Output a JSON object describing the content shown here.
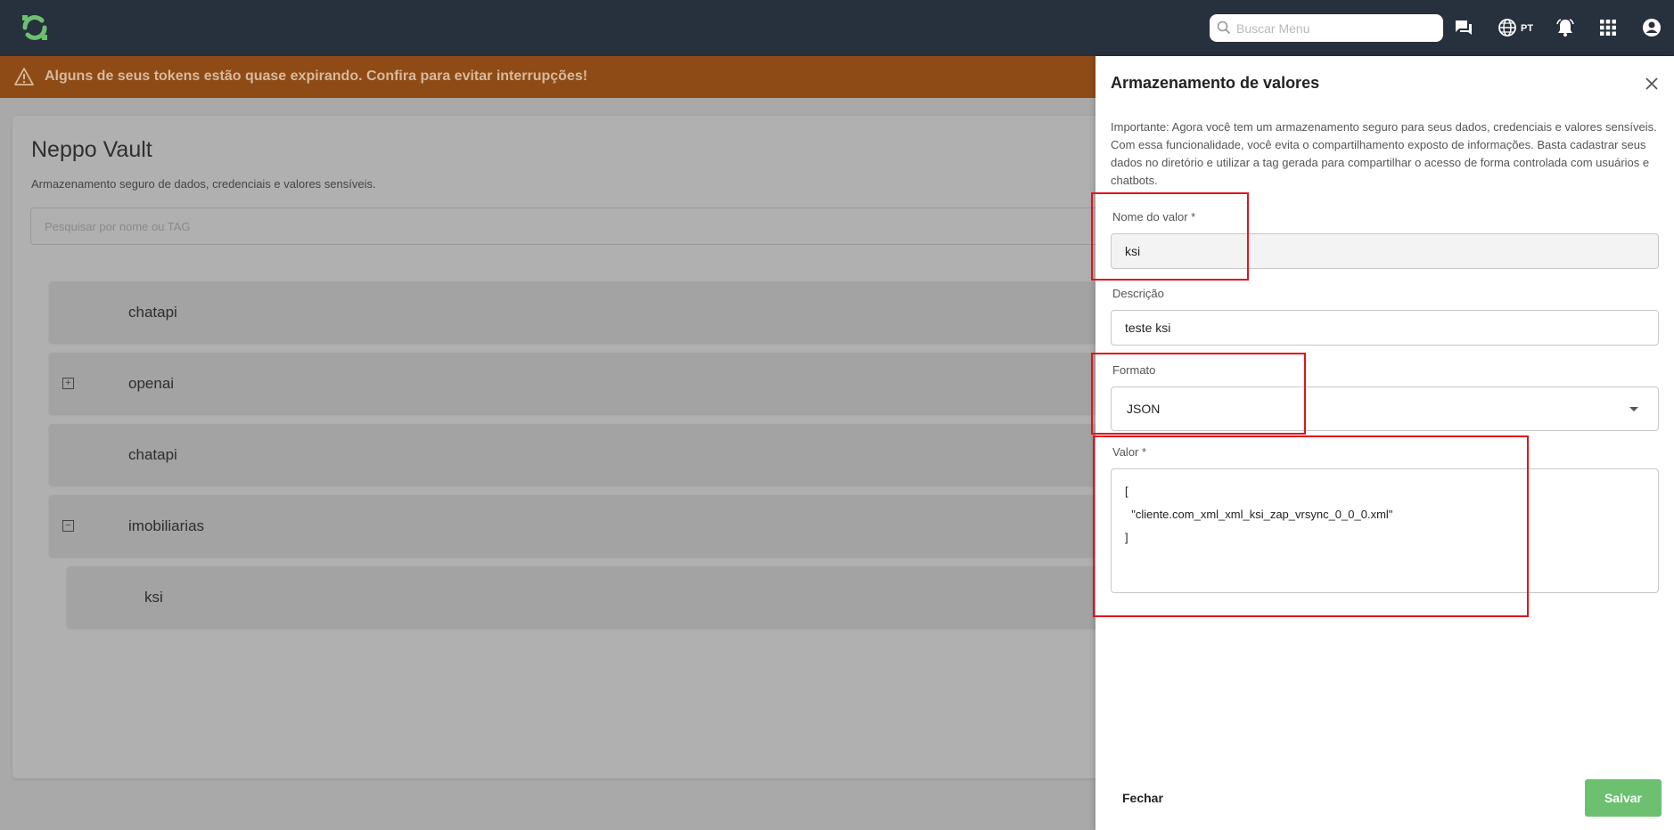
{
  "topbar": {
    "search_placeholder": "Buscar Menu",
    "language": "PT",
    "icons": [
      "logo-icon",
      "search-icon",
      "chat-icon",
      "globe-icon",
      "bell-icon",
      "apps-grid-icon",
      "account-icon"
    ]
  },
  "banner": {
    "message": "Alguns de seus tokens estão quase expirando. Confira para evitar interrupções!"
  },
  "vault": {
    "title": "Neppo Vault",
    "subtitle": "Armazenamento seguro de dados, credenciais e valores sensíveis.",
    "search_placeholder": "Pesquisar por nome ou TAG",
    "items": [
      {
        "label": "chatapi",
        "toggle": ""
      },
      {
        "label": "openai",
        "toggle": "+"
      },
      {
        "label": "chatapi",
        "toggle": ""
      },
      {
        "label": "imobiliarias",
        "toggle": "−"
      },
      {
        "label": "ksi",
        "toggle": ""
      }
    ]
  },
  "drawer": {
    "title": "Armazenamento de valores",
    "intro": "Importante: Agora você tem um armazenamento seguro para seus dados, credenciais e valores sensíveis. Com essa funcionalidade, você evita o compartilhamento exposto de informações. Basta cadastrar seus dados no diretório e utilizar a tag gerada para compartilhar o acesso de forma controlada com usuários e chatbots.",
    "name_label": "Nome do valor *",
    "name_value": "ksi",
    "description_label": "Descrição",
    "description_value": "teste ksi",
    "format_label": "Formato",
    "format_value": "JSON",
    "value_label": "Valor *",
    "value_content": "[\n  \"cliente.com_xml_xml_ksi_zap_vrsync_0_0_0.xml\"\n]",
    "close_label": "Fechar",
    "save_label": "Salvar"
  },
  "colors": {
    "topbar": "#27303d",
    "banner": "#8e4b16",
    "accent_green": "#6cc070",
    "highlight_red": "#e0141c"
  }
}
